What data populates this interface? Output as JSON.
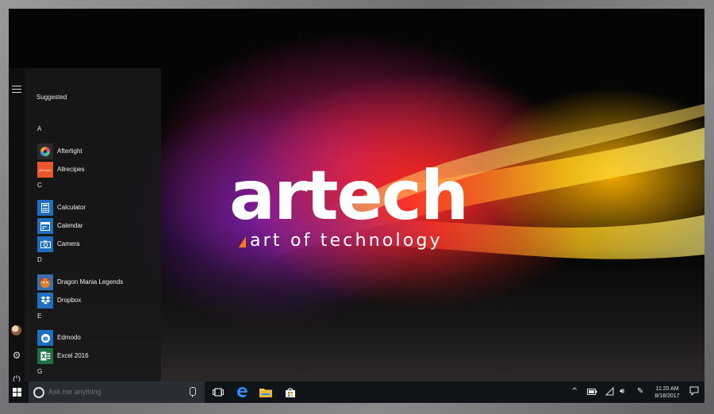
{
  "wallpaper": {
    "logo": "artech",
    "tagline": "art of technology"
  },
  "start_menu": {
    "suggested_label": "Suggested",
    "sections": [
      {
        "letter": "A",
        "apps": [
          {
            "name": "Afterlight",
            "icon": "afterlight-icon",
            "color": "#2b2b2b"
          },
          {
            "name": "Allrecipes",
            "icon": "allrecipes-icon",
            "color": "#e8562a",
            "tile_text": "allrecipes"
          }
        ]
      },
      {
        "letter": "C",
        "apps": [
          {
            "name": "Calculator",
            "icon": "calculator-icon",
            "color": "#1f6fbf"
          },
          {
            "name": "Calendar",
            "icon": "calendar-icon",
            "color": "#1f6fbf"
          },
          {
            "name": "Camera",
            "icon": "camera-icon",
            "color": "#1f6fbf"
          }
        ]
      },
      {
        "letter": "D",
        "apps": [
          {
            "name": "Dragon Mania Legends",
            "icon": "dragon-mania-icon",
            "color": "#c0392b"
          },
          {
            "name": "Dropbox",
            "icon": "dropbox-icon",
            "color": "#1f6fbf"
          }
        ]
      },
      {
        "letter": "E",
        "apps": [
          {
            "name": "Edmodo",
            "icon": "edmodo-icon",
            "color": "#1f6fbf"
          },
          {
            "name": "Excel 2016",
            "icon": "excel-icon",
            "color": "#1e7145"
          }
        ]
      },
      {
        "letter": "G",
        "apps": []
      }
    ]
  },
  "taskbar": {
    "search_placeholder": "Ask me anything",
    "pinned": [
      "task-view-icon",
      "edge-icon",
      "file-explorer-icon",
      "store-icon"
    ],
    "tray": [
      "chevron-up-icon",
      "battery-icon",
      "wifi-icon",
      "volume-icon",
      "pen-icon"
    ],
    "time": "11:20 AM",
    "date": "8/18/2017",
    "accent": "#1f6fbf"
  }
}
